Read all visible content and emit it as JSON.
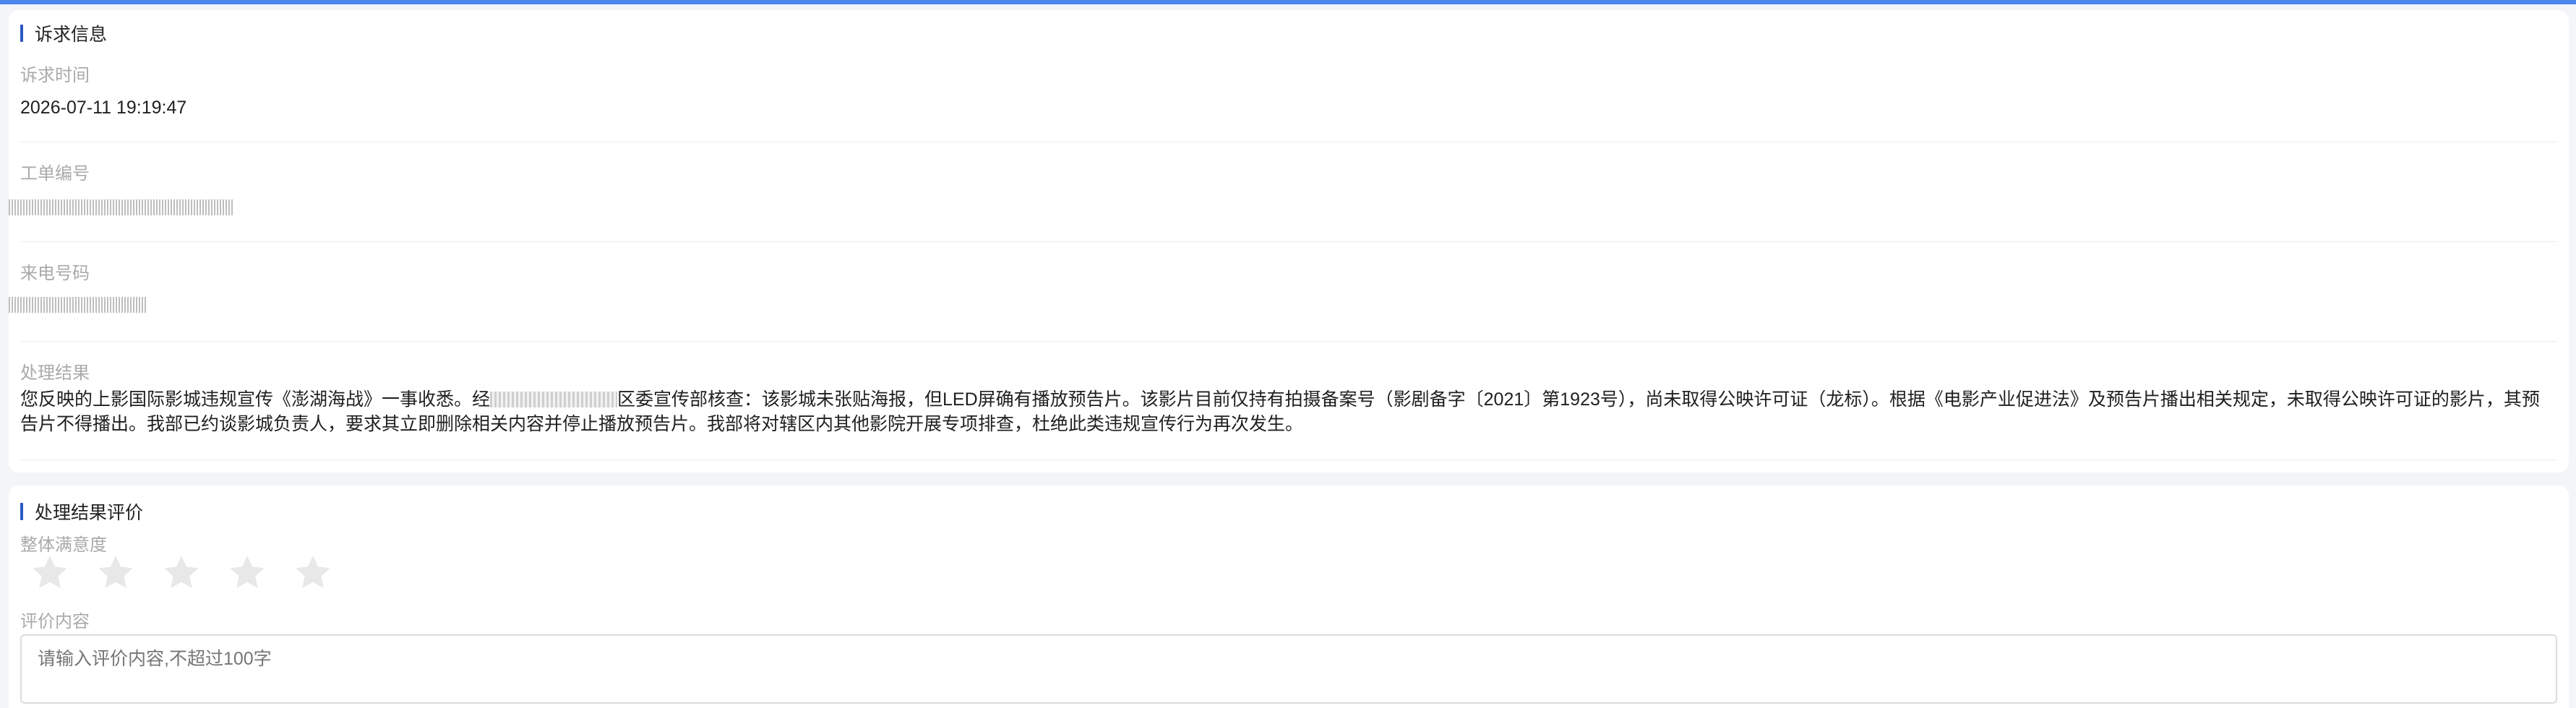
{
  "complaint": {
    "section_title": "诉求信息",
    "time_label": "诉求时间",
    "time_value": "2026-07-11 19:19:47",
    "order_label": "工单编号",
    "phone_label": "来电号码",
    "result_label": "处理结果",
    "result_text_before": "您反映的上影国际影城违规宣传《澎湖海战》一事收悉。经",
    "result_text_after": "区委宣传部核查：该影城未张贴海报，但LED屏确有播放预告片。该影片目前仅持有拍摄备案号（影剧备字〔2021〕第1923号），尚未取得公映许可证（龙标）。根据《电影产业促进法》及预告片播出相关规定，未取得公映许可证的影片，其预告片不得播出。我部已约谈影城负责人，要求其立即删除相关内容并停止播放预告片。我部将对辖区内其他影院开展专项排查，杜绝此类违规宣传行为再次发生。"
  },
  "evaluation": {
    "section_title": "处理结果评价",
    "satisfaction_label": "整体满意度",
    "rating": 0,
    "max_rating": 5,
    "content_label": "评价内容",
    "content_placeholder": "请输入评价内容,不超过100字",
    "content_value": ""
  },
  "colors": {
    "accent": "#2b59c3",
    "top_bar": "#4a86ec",
    "star_empty": "#e8e8e8"
  }
}
